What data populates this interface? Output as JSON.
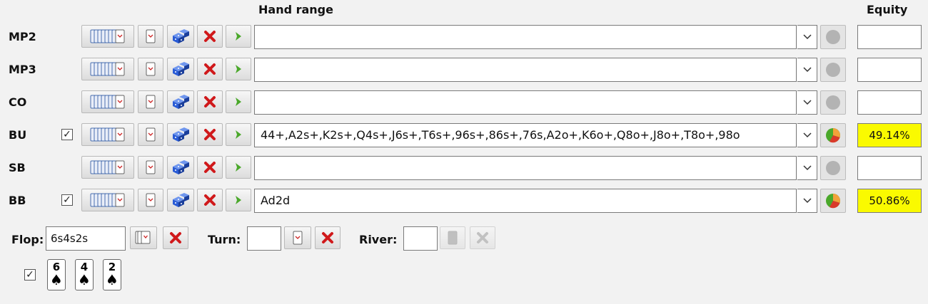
{
  "headers": {
    "hand_range": "Hand range",
    "equity": "Equity"
  },
  "players": [
    {
      "position": "MP2",
      "checked": false,
      "range": "",
      "equity": "",
      "has_result": false
    },
    {
      "position": "MP3",
      "checked": false,
      "range": "",
      "equity": "",
      "has_result": false
    },
    {
      "position": "CO",
      "checked": false,
      "range": "",
      "equity": "",
      "has_result": false
    },
    {
      "position": "BU",
      "checked": true,
      "range": "44+,A2s+,K2s+,Q4s+,J6s+,T6s+,96s+,86s+,76s,A2o+,K6o+,Q8o+,J8o+,T8o+,98o",
      "equity": "49.14%",
      "has_result": true
    },
    {
      "position": "SB",
      "checked": false,
      "range": "",
      "equity": "",
      "has_result": false
    },
    {
      "position": "BB",
      "checked": true,
      "range": "Ad2d",
      "equity": "50.86%",
      "has_result": true
    }
  ],
  "board": {
    "flop_label": "Flop:",
    "flop_value": "6s4s2s",
    "turn_label": "Turn:",
    "turn_value": "",
    "river_label": "River:",
    "river_value": ""
  },
  "board_cards_checked": true,
  "board_cards": [
    {
      "rank": "6",
      "suit": "♠"
    },
    {
      "rank": "4",
      "suit": "♠"
    },
    {
      "rank": "2",
      "suit": "♠"
    }
  ],
  "colors": {
    "highlight": "#fafa00",
    "remove": "#d0191b",
    "arrow": "#4aa82a",
    "dice": "#2a5cd6"
  }
}
